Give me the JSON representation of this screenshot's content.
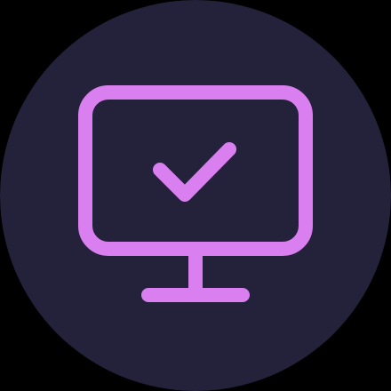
{
  "icon": {
    "name": "monitor-check-icon",
    "colors": {
      "page_background": "#000000",
      "circle_background": "#24213a",
      "stroke": "#d97ff0"
    }
  }
}
